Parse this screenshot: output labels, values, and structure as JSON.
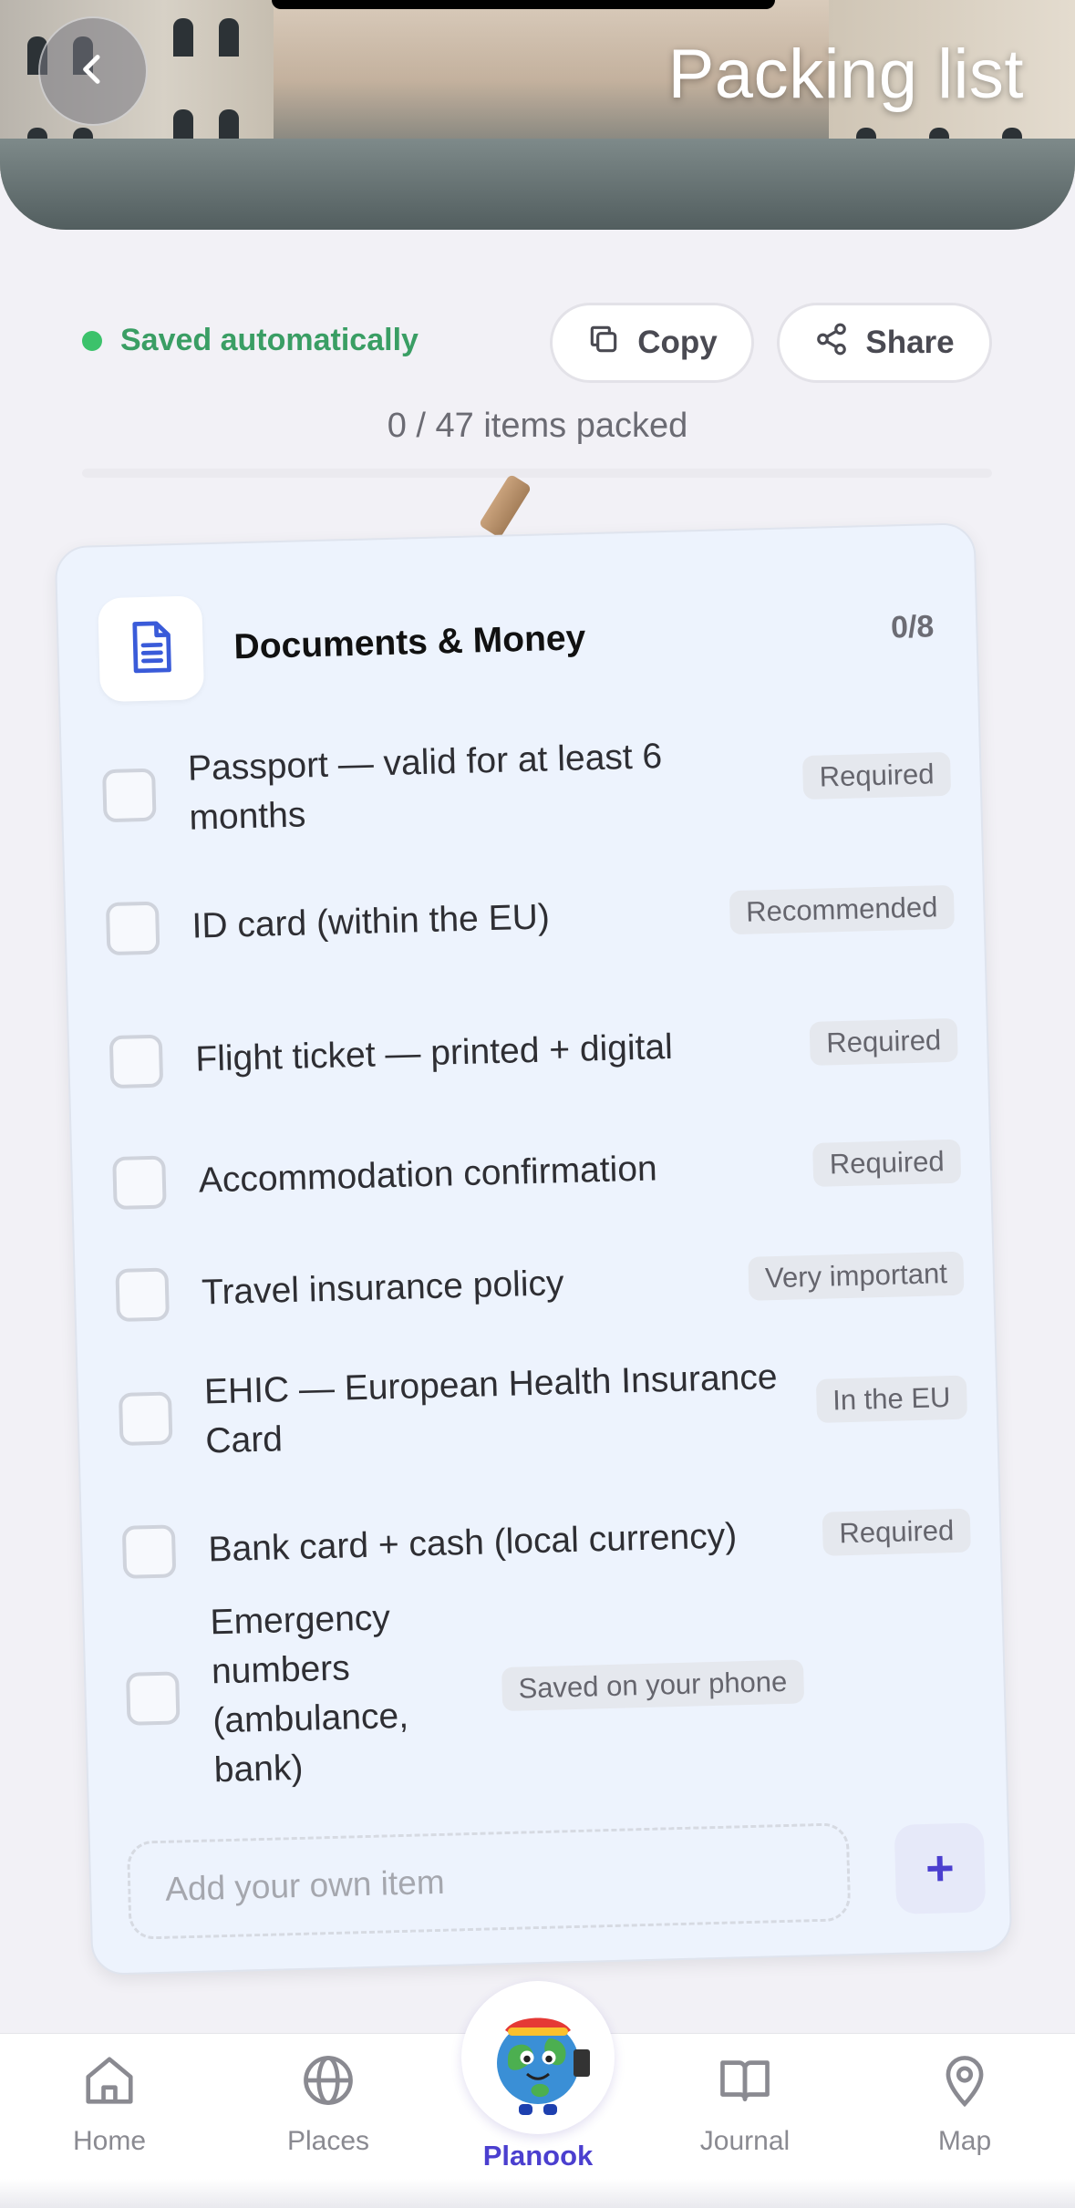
{
  "header": {
    "title": "Packing list",
    "back_icon": "chevron-left-icon"
  },
  "status": {
    "saved_text": "Saved automatically",
    "saved_color": "#3cc26b",
    "copy_label": "Copy",
    "share_label": "Share",
    "progress_text": "0 / 47 items packed",
    "packed": 0,
    "total": 47
  },
  "card": {
    "icon": "document-icon",
    "title": "Documents & Money",
    "count": "0/8",
    "items": [
      {
        "label": "Passport — valid for at least 6 months",
        "tag": "Required",
        "checked": false
      },
      {
        "label": "ID card (within the EU)",
        "tag": "Recommended",
        "checked": false
      },
      {
        "label": "Flight ticket — printed + digital",
        "tag": "Required",
        "checked": false
      },
      {
        "label": "Accommodation confirmation",
        "tag": "Required",
        "checked": false
      },
      {
        "label": "Travel insurance policy",
        "tag": "Very important",
        "checked": false
      },
      {
        "label": "EHIC — European Health Insurance Card",
        "tag": "In the EU",
        "checked": false
      },
      {
        "label": "Bank card + cash (local currency)",
        "tag": "Required",
        "checked": false
      },
      {
        "label": "Emergency numbers (ambulance, bank)",
        "tag": "Saved on your phone",
        "checked": false
      }
    ],
    "add_placeholder": "Add your own item",
    "add_button": "+"
  },
  "tabbar": {
    "home": "Home",
    "places": "Places",
    "center": "Planook",
    "journal": "Journal",
    "map": "Map"
  },
  "colors": {
    "accent": "#4b3fcf",
    "card_bg": "#edf3fd",
    "saved_text": "#3a9e64"
  }
}
